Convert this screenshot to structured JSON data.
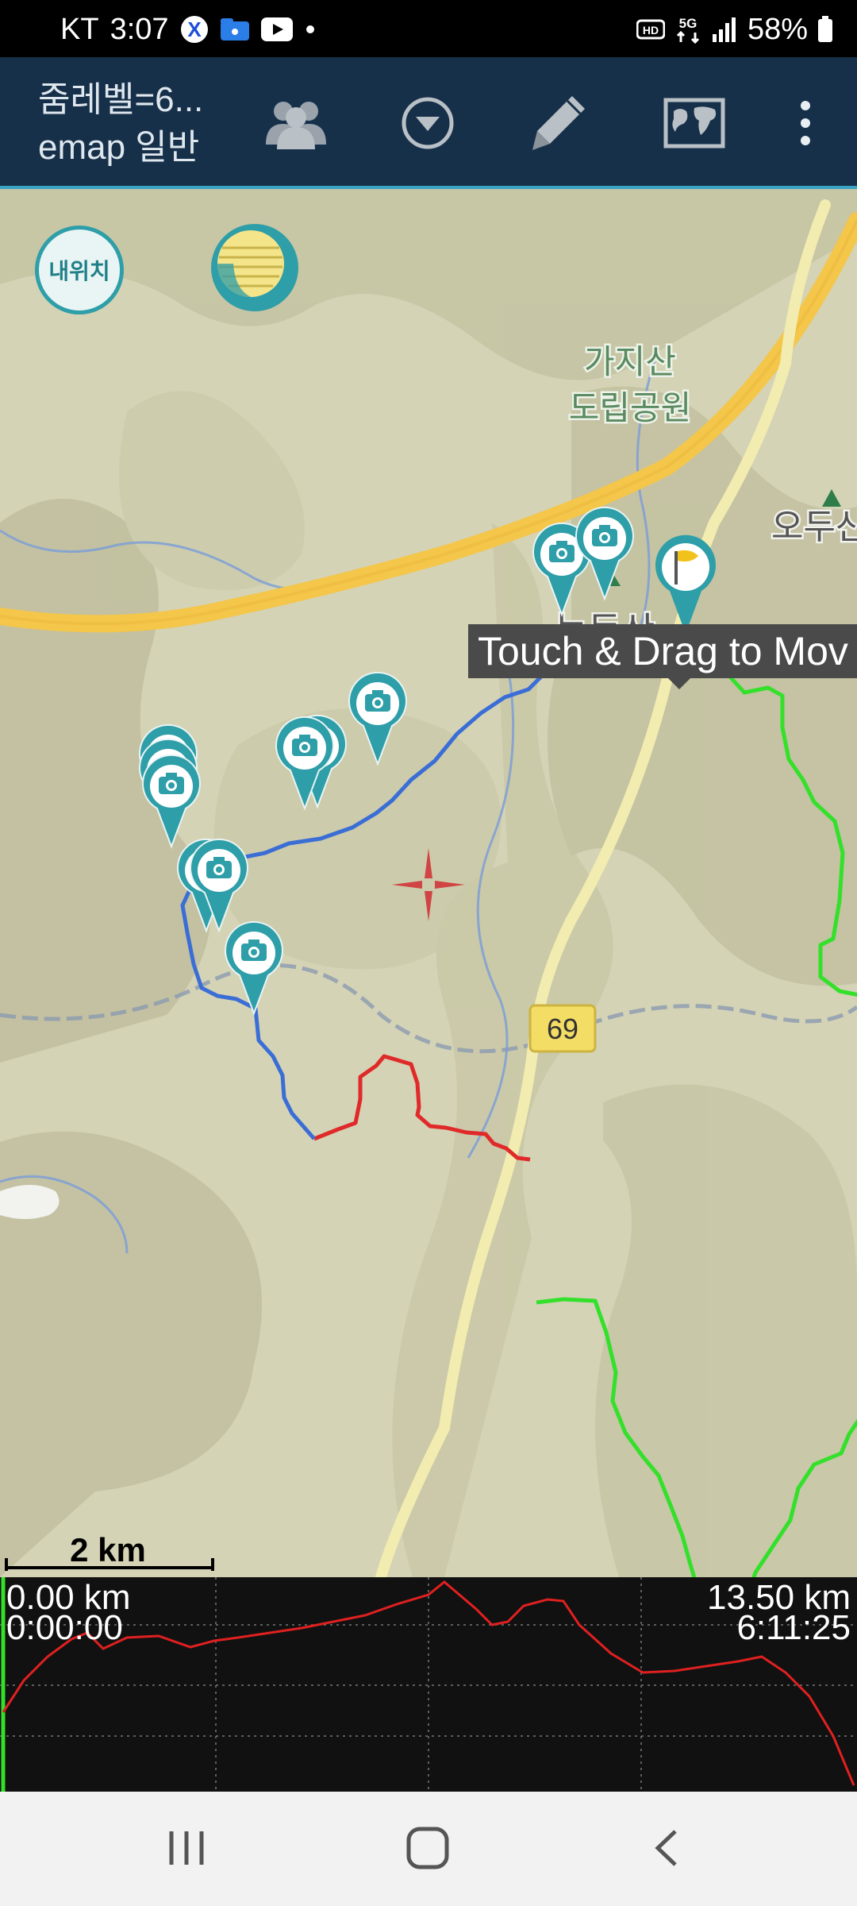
{
  "status_bar": {
    "carrier": "KT",
    "time": "3:07",
    "battery": "58%",
    "network": "5G",
    "hd": "HD"
  },
  "toolbar": {
    "title_line1": "줌레벨=6...",
    "title_line2": "emap 일반",
    "buttons": [
      {
        "icon": "people-icon"
      },
      {
        "icon": "dropdown-circle-icon"
      },
      {
        "icon": "pencil-icon"
      },
      {
        "icon": "world-map-icon"
      },
      {
        "icon": "more-vert-icon"
      }
    ]
  },
  "map": {
    "my_location_label": "내위치",
    "tooltip": "Touch & Drag to Mov",
    "labels": {
      "park_line1": "가지산",
      "park_line2": "도립공원",
      "peak": "능동산",
      "road_number": "69",
      "place_right": "오두산"
    },
    "scale": {
      "label": "2 km"
    },
    "track_colors": {
      "recorded": "#3a6ed6",
      "planned": "#e02a2a",
      "other": "#33e02a"
    },
    "photo_marker_color": "#2e9ea8"
  },
  "profile": {
    "start_distance": "0.00 km",
    "start_time": "0:00:00",
    "end_distance": "13.50 km",
    "end_time": "6:11:25",
    "line_color": "#e02020"
  },
  "nav": {
    "recents": "recents-icon",
    "home": "home-icon",
    "back": "back-icon"
  }
}
